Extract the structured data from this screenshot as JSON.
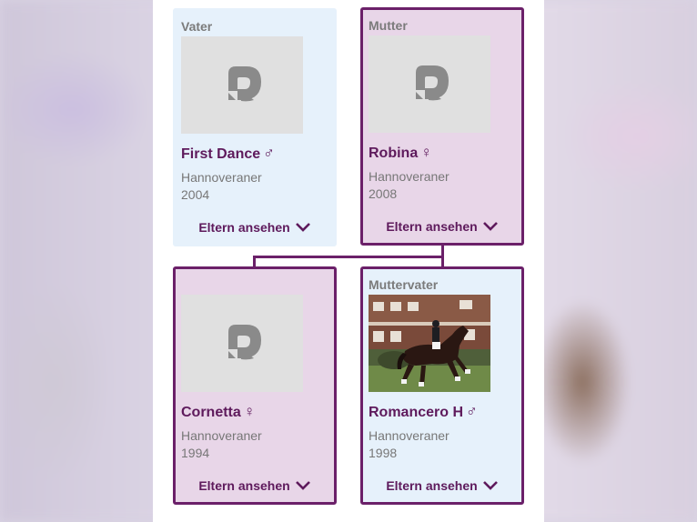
{
  "cards": [
    {
      "role": "Vater",
      "name": "First Dance",
      "sex_symbol": "♂",
      "breed": "Hannoveraner",
      "year": "2004",
      "button": "Eltern ansehen",
      "photo": "placeholder-logo-icon"
    },
    {
      "role": "Mutter",
      "name": "Robina",
      "sex_symbol": "♀",
      "breed": "Hannoveraner",
      "year": "2008",
      "button": "Eltern ansehen",
      "photo": "placeholder-logo-icon"
    },
    {
      "role": "",
      "name": "Cornetta",
      "sex_symbol": "♀",
      "breed": "Hannoveraner",
      "year": "1994",
      "button": "Eltern ansehen",
      "photo": "placeholder-logo-icon"
    },
    {
      "role": "Muttervater",
      "name": "Romancero H",
      "sex_symbol": "♂",
      "breed": "Hannoveraner",
      "year": "1998",
      "button": "Eltern ansehen",
      "photo": "horse-dressage-photo"
    }
  ],
  "colors": {
    "accent": "#5e1a5c",
    "highlight_border": "#6b2069",
    "male_bg": "#e6f1fb",
    "female_bg": "#e8d6e8"
  }
}
